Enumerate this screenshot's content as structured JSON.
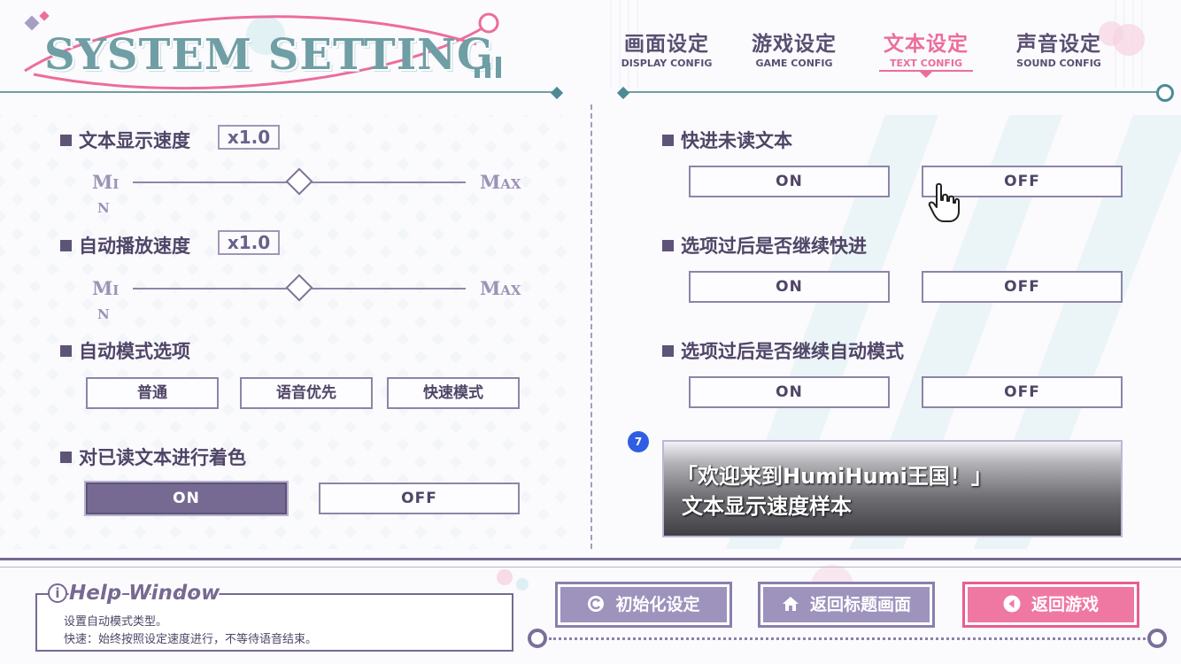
{
  "header": {
    "logo_text": "SYSTEM SETTING",
    "tabs": [
      {
        "label": "画面设定",
        "sub": "DISPLAY CONFIG"
      },
      {
        "label": "游戏设定",
        "sub": "GAME CONFIG"
      },
      {
        "label": "文本设定",
        "sub": "TEXT CONFIG",
        "active": true
      },
      {
        "label": "声音设定",
        "sub": "SOUND CONFIG"
      }
    ]
  },
  "left": {
    "text_speed": {
      "label": "文本显示速度",
      "value": "x1.0",
      "min": "MIN",
      "max": "MAX",
      "level": 0.5
    },
    "auto_speed": {
      "label": "自动播放速度",
      "value": "x1.0",
      "min": "MIN",
      "max": "MAX",
      "level": 0.5
    },
    "auto_mode": {
      "label": "自动模式选项",
      "options": [
        "普通",
        "语音优先",
        "快速模式"
      ]
    },
    "color_read": {
      "label": "对已读文本进行着色",
      "on": "ON",
      "off": "OFF",
      "selected": "ON"
    }
  },
  "right": {
    "skip_unread": {
      "label": "快进未读文本",
      "on": "ON",
      "off": "OFF"
    },
    "continue_skip": {
      "label": "选项过后是否继续快进",
      "on": "ON",
      "off": "OFF"
    },
    "continue_auto": {
      "label": "选项过后是否继续自动模式",
      "on": "ON",
      "off": "OFF"
    },
    "badge": "7",
    "preview_line1": "「欢迎来到HumiHumi王国！」",
    "preview_line2": "文本显示速度样本"
  },
  "footer": {
    "help_title": "Help Window",
    "help_line1": "设置自动模式类型。",
    "help_line2": "快速：始终按照设定速度进行，不等待语音结束。",
    "btn_reset": "初始化设定",
    "btn_title": "返回标题画面",
    "btn_back": "返回游戏"
  },
  "colors": {
    "accent_pink": "#ec6d9c",
    "purple": "#766a92",
    "teal": "#6f9ea4"
  },
  "icons": [
    "reset-icon",
    "home-icon",
    "back-arrow-icon",
    "info-icon",
    "hand-cursor-icon"
  ]
}
